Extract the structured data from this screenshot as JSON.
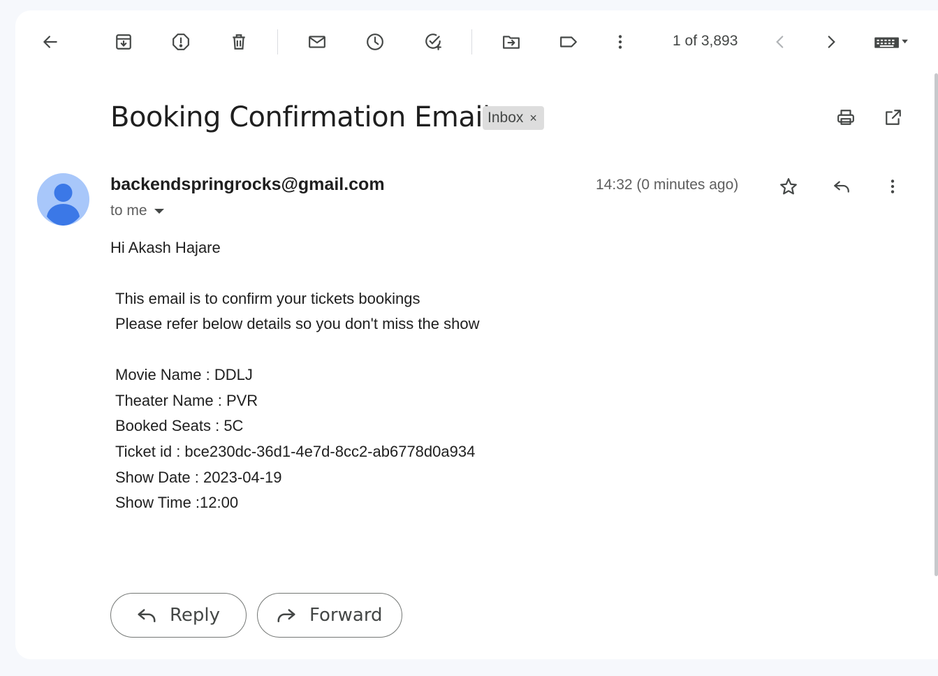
{
  "toolbar": {
    "pager_text": "1 of 3,893"
  },
  "email": {
    "subject": "Booking Confirmation Email",
    "label": "Inbox",
    "label_close": "×",
    "sender": "backendspringrocks@gmail.com",
    "recipient": "to me",
    "timestamp": "14:32 (0 minutes ago)",
    "greeting": "Hi Akash Hajare",
    "lines": [
      "This email is to confirm your tickets bookings",
      "Please refer below details so you don't miss the show",
      "Movie Name : DDLJ",
      "Theater Name : PVR",
      "Booked Seats : 5C",
      "Ticket id : bce230dc-36d1-4e7d-8cc2-ab6778d0a934",
      "Show Date : 2023-04-19",
      "Show Time :12:00"
    ]
  },
  "actions": {
    "reply_label": "Reply",
    "forward_label": "Forward"
  },
  "colors": {
    "avatar_bg": "#a8c7fa",
    "avatar_fg": "#4285f4",
    "page_bg": "#f6f8fc"
  }
}
